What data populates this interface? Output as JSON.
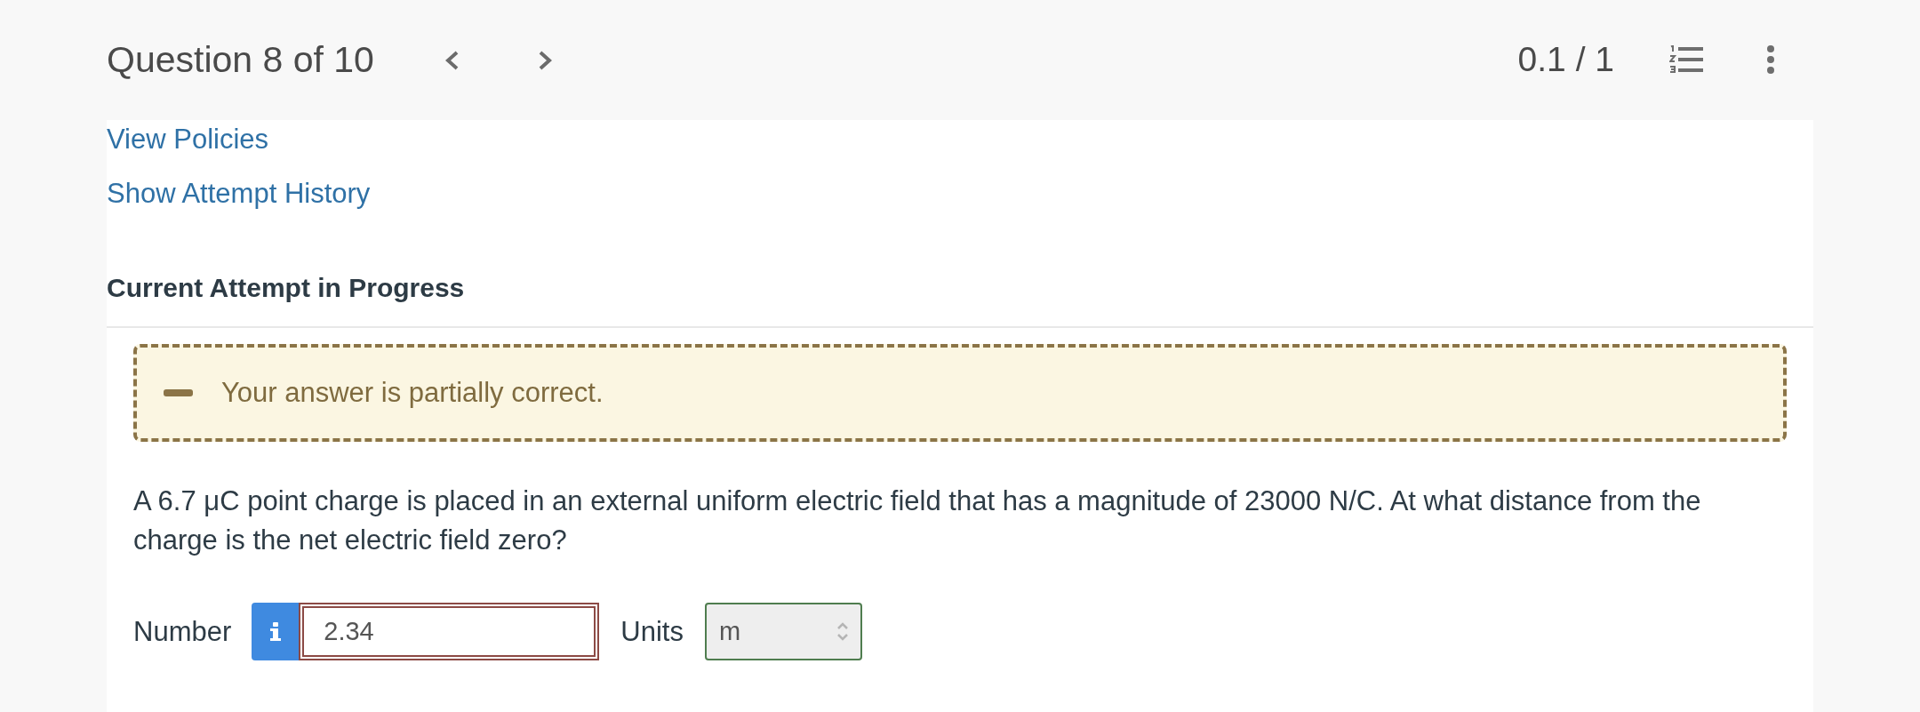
{
  "header": {
    "title": "Question 8 of 10",
    "score": "0.1 / 1"
  },
  "links": [
    "View Policies",
    "Show Attempt History"
  ],
  "section_title": "Current Attempt in Progress",
  "feedback": {
    "kind": "partial",
    "message": "Your answer is partially correct."
  },
  "question": "A 6.7 μC point charge is placed in an external uniform electric field that has a magnitude of 23000 N/C. At what distance from the charge is the net electric field zero?",
  "answer": {
    "number": {
      "label": "Number",
      "value": "2.34",
      "correct": false
    },
    "units": {
      "label": "Units",
      "value": "m",
      "correct": true
    }
  }
}
